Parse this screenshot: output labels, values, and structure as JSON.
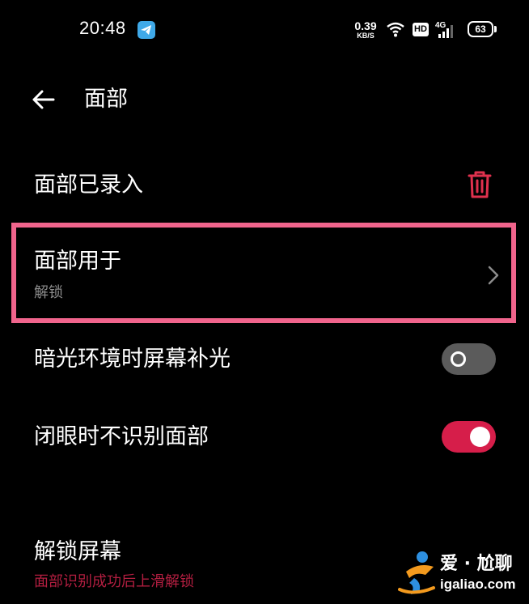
{
  "status_bar": {
    "time": "20:48",
    "net_speed_value": "0.39",
    "net_speed_unit": "KB/S",
    "hd_label": "HD",
    "network_label": "4G",
    "battery_level": "63"
  },
  "header": {
    "title": "面部"
  },
  "face_enrolled": {
    "label": "面部已录入"
  },
  "face_usage": {
    "label": "面部用于",
    "value": "解锁"
  },
  "low_light_fill": {
    "label": "暗光环境时屏幕补光",
    "enabled": false
  },
  "eyes_closed": {
    "label": "闭眼时不识别面部",
    "enabled": true
  },
  "unlock_screen": {
    "label": "解锁屏幕",
    "value": "面部识别成功后上滑解锁"
  },
  "watermark": {
    "line1": "爱 · 尬聊",
    "line2": "igaliao.com"
  },
  "colors": {
    "background": "#000000",
    "highlight_border": "#f0648c",
    "toggle_on": "#d61e4a",
    "toggle_off": "#5b5b5b",
    "delete_icon": "#e0314e",
    "accent_text": "#b21e40"
  }
}
